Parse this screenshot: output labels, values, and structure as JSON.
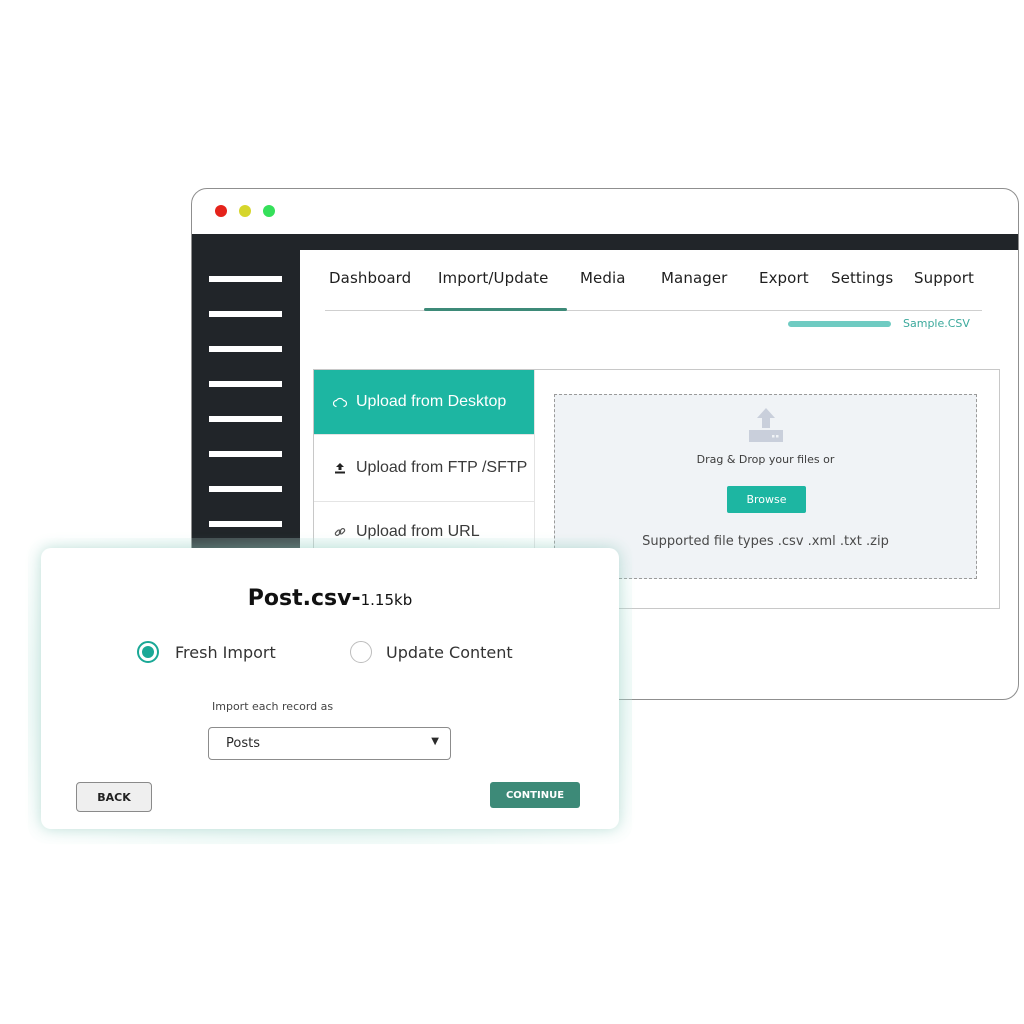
{
  "window": {
    "controls": [
      "close",
      "minimize",
      "maximize"
    ],
    "colors": {
      "close": "#e5231b",
      "minimize": "#d6d62c",
      "maximize": "#35e05a"
    }
  },
  "sidebar": {
    "menu_item_count": 8
  },
  "nav": {
    "items": [
      {
        "label": "Dashboard",
        "active": false
      },
      {
        "label": "Import/Update",
        "active": true
      },
      {
        "label": "Media",
        "active": false
      },
      {
        "label": "Manager",
        "active": false
      },
      {
        "label": "Export",
        "active": false
      },
      {
        "label": "Settings",
        "active": false
      },
      {
        "label": "Support",
        "active": false
      }
    ],
    "accent": "#3d8a78"
  },
  "upload_progress": {
    "file": "Sample.CSV",
    "progress": 1.0,
    "color": "#6fcbc2"
  },
  "upload_tabs": [
    {
      "label": "Upload from Desktop",
      "icon": "cloud-upload-icon",
      "active": true
    },
    {
      "label": "Upload from FTP /SFTP",
      "icon": "upload-icon",
      "active": false
    },
    {
      "label": "Upload from URL",
      "icon": "link-icon",
      "active": false
    }
  ],
  "dropzone": {
    "icon": "upload-tray-icon",
    "text": "Drag & Drop your files or",
    "browse_label": "Browse",
    "supported": "Supported file types .csv .xml .txt .zip"
  },
  "modal": {
    "file_name": "Post.csv-",
    "file_size": "1.15kb",
    "options": [
      {
        "label": "Fresh Import",
        "checked": true
      },
      {
        "label": "Update Content",
        "checked": false
      }
    ],
    "record_label": "Import each record as",
    "record_value": "Posts",
    "back_label": "BACK",
    "continue_label": "CONTINUE"
  },
  "colors": {
    "teal": "#1db6a2",
    "dark": "#212529",
    "continue": "#3d8a78"
  }
}
